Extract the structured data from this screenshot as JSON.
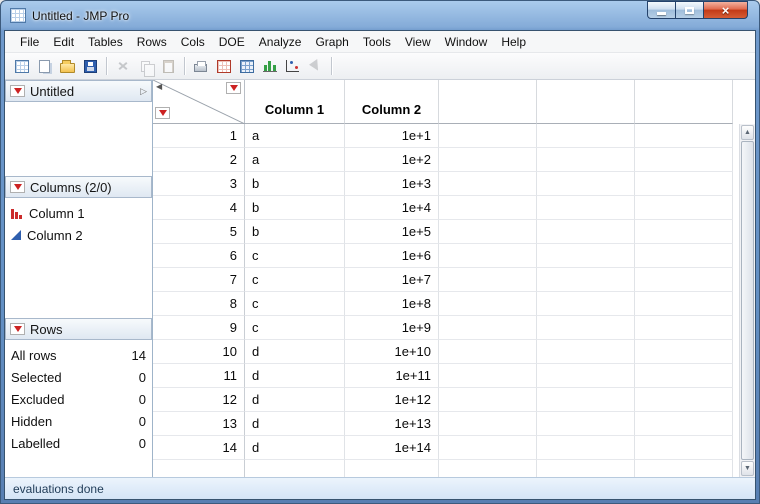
{
  "window": {
    "title": "Untitled - JMP Pro",
    "status": "evaluations done"
  },
  "menu": {
    "items": [
      "File",
      "Edit",
      "Tables",
      "Rows",
      "Cols",
      "DOE",
      "Analyze",
      "Graph",
      "Tools",
      "View",
      "Window",
      "Help"
    ]
  },
  "toolbar": {
    "icons": [
      "new-data-table",
      "new-window",
      "open",
      "save",
      "cut",
      "copy",
      "paste",
      "print",
      "data-table-red",
      "journal-table",
      "distribution",
      "fit-y-by-x",
      "selection-tool"
    ]
  },
  "sidebar": {
    "table_panel": {
      "title": "Untitled"
    },
    "columns_panel": {
      "title": "Columns (2/0)",
      "items": [
        {
          "label": "Column 1",
          "type": "nominal"
        },
        {
          "label": "Column 2",
          "type": "continuous"
        }
      ]
    },
    "rows_panel": {
      "title": "Rows",
      "stats": [
        {
          "label": "All rows",
          "value": "14"
        },
        {
          "label": "Selected",
          "value": "0"
        },
        {
          "label": "Excluded",
          "value": "0"
        },
        {
          "label": "Hidden",
          "value": "0"
        },
        {
          "label": "Labelled",
          "value": "0"
        }
      ]
    }
  },
  "table": {
    "headers": [
      "Column 1",
      "Column 2"
    ],
    "rows": [
      {
        "n": "1",
        "c1": "a",
        "c2": "1e+1"
      },
      {
        "n": "2",
        "c1": "a",
        "c2": "1e+2"
      },
      {
        "n": "3",
        "c1": "b",
        "c2": "1e+3"
      },
      {
        "n": "4",
        "c1": "b",
        "c2": "1e+4"
      },
      {
        "n": "5",
        "c1": "b",
        "c2": "1e+5"
      },
      {
        "n": "6",
        "c1": "c",
        "c2": "1e+6"
      },
      {
        "n": "7",
        "c1": "c",
        "c2": "1e+7"
      },
      {
        "n": "8",
        "c1": "c",
        "c2": "1e+8"
      },
      {
        "n": "9",
        "c1": "c",
        "c2": "1e+9"
      },
      {
        "n": "10",
        "c1": "d",
        "c2": "1e+10"
      },
      {
        "n": "11",
        "c1": "d",
        "c2": "1e+11"
      },
      {
        "n": "12",
        "c1": "d",
        "c2": "1e+12"
      },
      {
        "n": "13",
        "c1": "d",
        "c2": "1e+13"
      },
      {
        "n": "14",
        "c1": "d",
        "c2": "1e+14"
      }
    ]
  }
}
